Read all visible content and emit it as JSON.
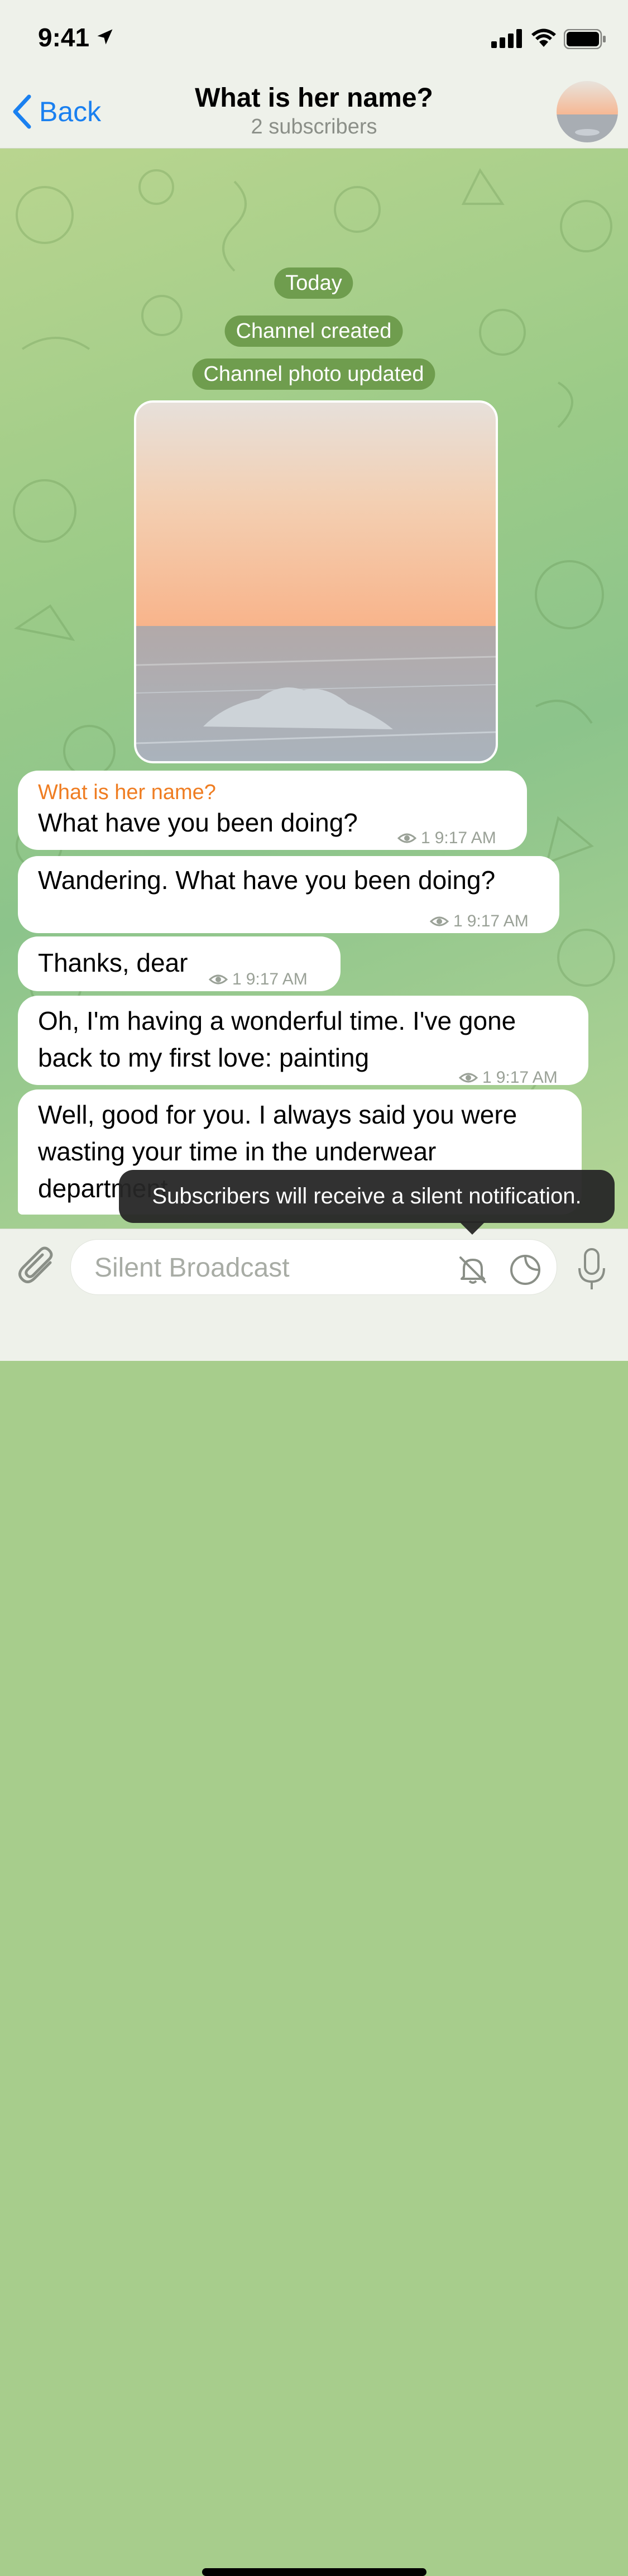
{
  "status_bar": {
    "time": "9:41"
  },
  "header": {
    "back_label": "Back",
    "title": "What is her name?",
    "subtitle": "2 subscribers"
  },
  "chat": {
    "service_messages": [
      "Today",
      "Channel created",
      "Channel photo updated"
    ],
    "messages": [
      {
        "sender": "What is her name?",
        "text": "What have you been doing?",
        "views": "1",
        "time": "9:17 AM"
      },
      {
        "text": "Wandering. What have you been doing?",
        "views": "1",
        "time": "9:17 AM"
      },
      {
        "text": "Thanks, dear",
        "views": "1",
        "time": "9:17 AM"
      },
      {
        "text": "Oh, I'm having a wonderful time. I've gone back to my first love: painting",
        "views": "1",
        "time": "9:17 AM"
      },
      {
        "text": "Well, good for you. I always said you were wasting your time in the underwear department"
      }
    ]
  },
  "toast": {
    "text": "Subscribers will receive a silent notification."
  },
  "composer": {
    "placeholder": "Silent Broadcast"
  },
  "colors": {
    "accent": "#1a80f0",
    "sender_name": "#ef7d22",
    "service_pill": "#6f9d4e"
  },
  "icons": [
    "location-arrow-icon",
    "signal-icon",
    "wifi-icon",
    "battery-icon",
    "back-chevron-icon",
    "channel-avatar",
    "eye-icon",
    "paperclip-icon",
    "bell-off-icon",
    "sticker-icon",
    "microphone-icon"
  ]
}
